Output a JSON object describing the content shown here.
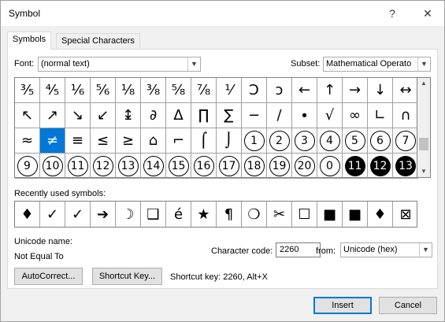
{
  "window": {
    "title": "Symbol",
    "help_label": "?",
    "close_label": "✕"
  },
  "tabs": [
    {
      "label": "Symbols"
    },
    {
      "label": "Special Characters"
    }
  ],
  "font": {
    "label": "Font:",
    "value": "(normal text)"
  },
  "subset": {
    "label": "Subset:",
    "value": "Mathematical Operato"
  },
  "symbol_grid": [
    [
      "⅗",
      "⅘",
      "⅙",
      "⅚",
      "⅛",
      "⅜",
      "⅝",
      "⅞",
      "⅟",
      "Ↄ",
      "ↄ",
      "←",
      "↑",
      "→",
      "↓",
      "↔",
      "↕"
    ],
    [
      "↖",
      "↗",
      "↘",
      "↙",
      "↨",
      "∂",
      "∆",
      "∏",
      "∑",
      "−",
      "∕",
      "∙",
      "√",
      "∞",
      "∟",
      "∩",
      "∫"
    ],
    [
      "≈",
      "≠",
      "≡",
      "≤",
      "≥",
      "⌂",
      "⌐",
      "⌠",
      "⌡",
      "①",
      "②",
      "③",
      "④",
      "⑤",
      "⑥",
      "⑦",
      "⑧"
    ],
    [
      "⑨",
      "⑩",
      "⑪",
      "⑫",
      "⑬",
      "⑭",
      "⑮",
      "⑯",
      "⑰",
      "⑱",
      "⑲",
      "⑳",
      "⓪",
      "⓫",
      "⓬",
      "⓭",
      "⓮"
    ]
  ],
  "grid_rows_display": [
    [
      "⅗",
      "⅘",
      "⅙",
      "⅚",
      "⅛",
      "⅜",
      "⅝",
      "⅟",
      "Ↄ",
      "ↄ",
      "←",
      "↑",
      "→",
      "↓",
      "↔",
      "↕"
    ],
    [
      "↖",
      "↗",
      "↘",
      "↙",
      "↨",
      "∂",
      "∆",
      "∏",
      "∑",
      "−",
      "∕",
      "∙",
      "√",
      "∞",
      "∟",
      "∩",
      "∫"
    ],
    [
      "≈",
      "≠",
      "≡",
      "≤",
      "≥",
      "⌂",
      "⌐",
      "⌠",
      "⌡",
      "1",
      "2",
      "3",
      "4",
      "5",
      "6",
      "7",
      "8"
    ],
    [
      "9",
      "10",
      "11",
      "12",
      "13",
      "14",
      "15",
      "16",
      "17",
      "18",
      "19",
      "20",
      "0",
      "11",
      "12",
      "13",
      "14"
    ]
  ],
  "selected_symbol": "≠",
  "recent": {
    "label": "Recently used symbols:",
    "symbols": [
      "♦",
      "✓",
      "✓",
      "➔",
      "☽",
      "❑",
      "é",
      "★",
      "¶",
      "❍",
      "✂",
      "☐",
      "■",
      "■",
      "♦",
      "⊠",
      "→"
    ]
  },
  "unicode_name": {
    "label": "Unicode name:",
    "value": "Not Equal To"
  },
  "char_code": {
    "label": "Character code:",
    "value": "2260"
  },
  "from": {
    "label": "from:",
    "value": "Unicode (hex)"
  },
  "buttons": {
    "autocorrect": "AutoCorrect...",
    "shortcut_key": "Shortcut Key...",
    "insert": "Insert",
    "cancel": "Cancel"
  },
  "shortcut_info": "Shortcut key: 2260, Alt+X"
}
